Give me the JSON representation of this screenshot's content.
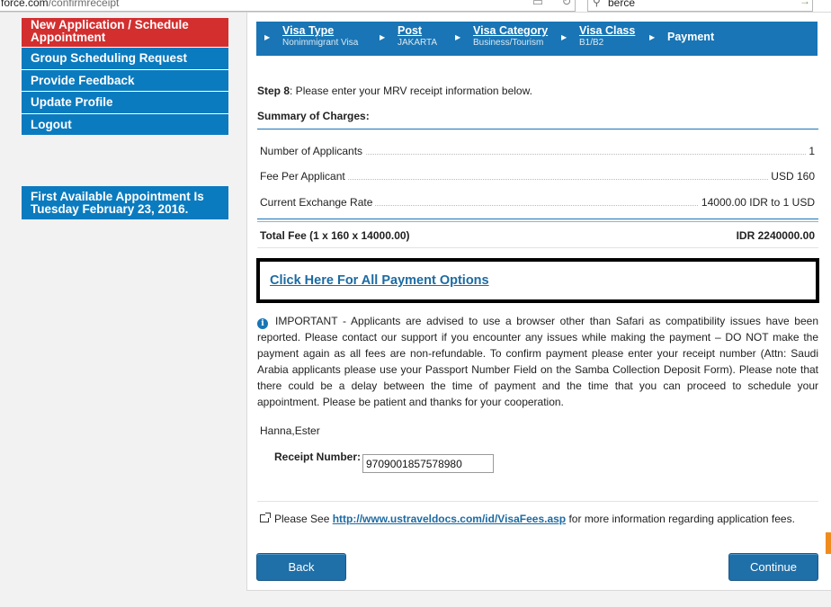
{
  "browser": {
    "url_domain": "force.com",
    "url_path": "/confirmreceipt",
    "search_text": "berce"
  },
  "nav": {
    "items": [
      {
        "label": "New Application / Schedule Appointment",
        "style": "red"
      },
      {
        "label": "Group Scheduling Request"
      },
      {
        "label": "Provide Feedback"
      },
      {
        "label": "Update Profile"
      },
      {
        "label": "Logout"
      }
    ],
    "availability": "First Available Appointment Is Tuesday February 23, 2016."
  },
  "steps": [
    {
      "title": "Visa Type",
      "sub": "Nonimmigrant Visa"
    },
    {
      "title": "Post",
      "sub": "JAKARTA"
    },
    {
      "title": "Visa Category",
      "sub": "Business/Tourism"
    },
    {
      "title": "Visa Class",
      "sub": "B1/B2"
    },
    {
      "title": "Payment",
      "sub": ""
    }
  ],
  "instructions": {
    "step_label": "Step 8",
    "step_text": ": Please enter your MRV receipt information below.",
    "summary_title": "Summary of Charges:"
  },
  "charges": [
    {
      "label": "Number of Applicants",
      "value": "1"
    },
    {
      "label": "Fee Per Applicant",
      "value": "USD 160"
    },
    {
      "label": "Current Exchange Rate",
      "value": "14000.00 IDR to 1 USD"
    }
  ],
  "total": {
    "label": "Total Fee (1 x 160 x 14000.00)",
    "value": "IDR 2240000.00"
  },
  "payment_link": "Click Here For All Payment Options",
  "important_text": "IMPORTANT - Applicants are advised to use a browser other than Safari as compatibility issues have been reported. Please contact our support if you encounter any issues while making the payment – DO NOT make the payment again as all fees are non-refundable. To confirm payment please enter your receipt number (Attn: Saudi Arabia applicants please use your Passport Number Field on the Samba Collection Deposit Form). Please note that there could be a delay between the time of payment and the time that you can proceed to schedule your appointment. Please be patient and thanks for your cooperation.",
  "applicant_name": "Hanna,Ester",
  "receipt": {
    "label": "Receipt Number:",
    "value": "9709001857578980"
  },
  "fees_note": {
    "prefix": "Please See ",
    "link": "http://www.ustraveldocs.com/id/VisaFees.asp",
    "suffix": " for more information regarding application fees."
  },
  "buttons": {
    "back": "Back",
    "continue": "Continue"
  },
  "colors": {
    "nav_blue": "#0b7bbf",
    "nav_red": "#d32f2f",
    "steps_blue": "#1975b5",
    "link": "#1b6aa3"
  }
}
